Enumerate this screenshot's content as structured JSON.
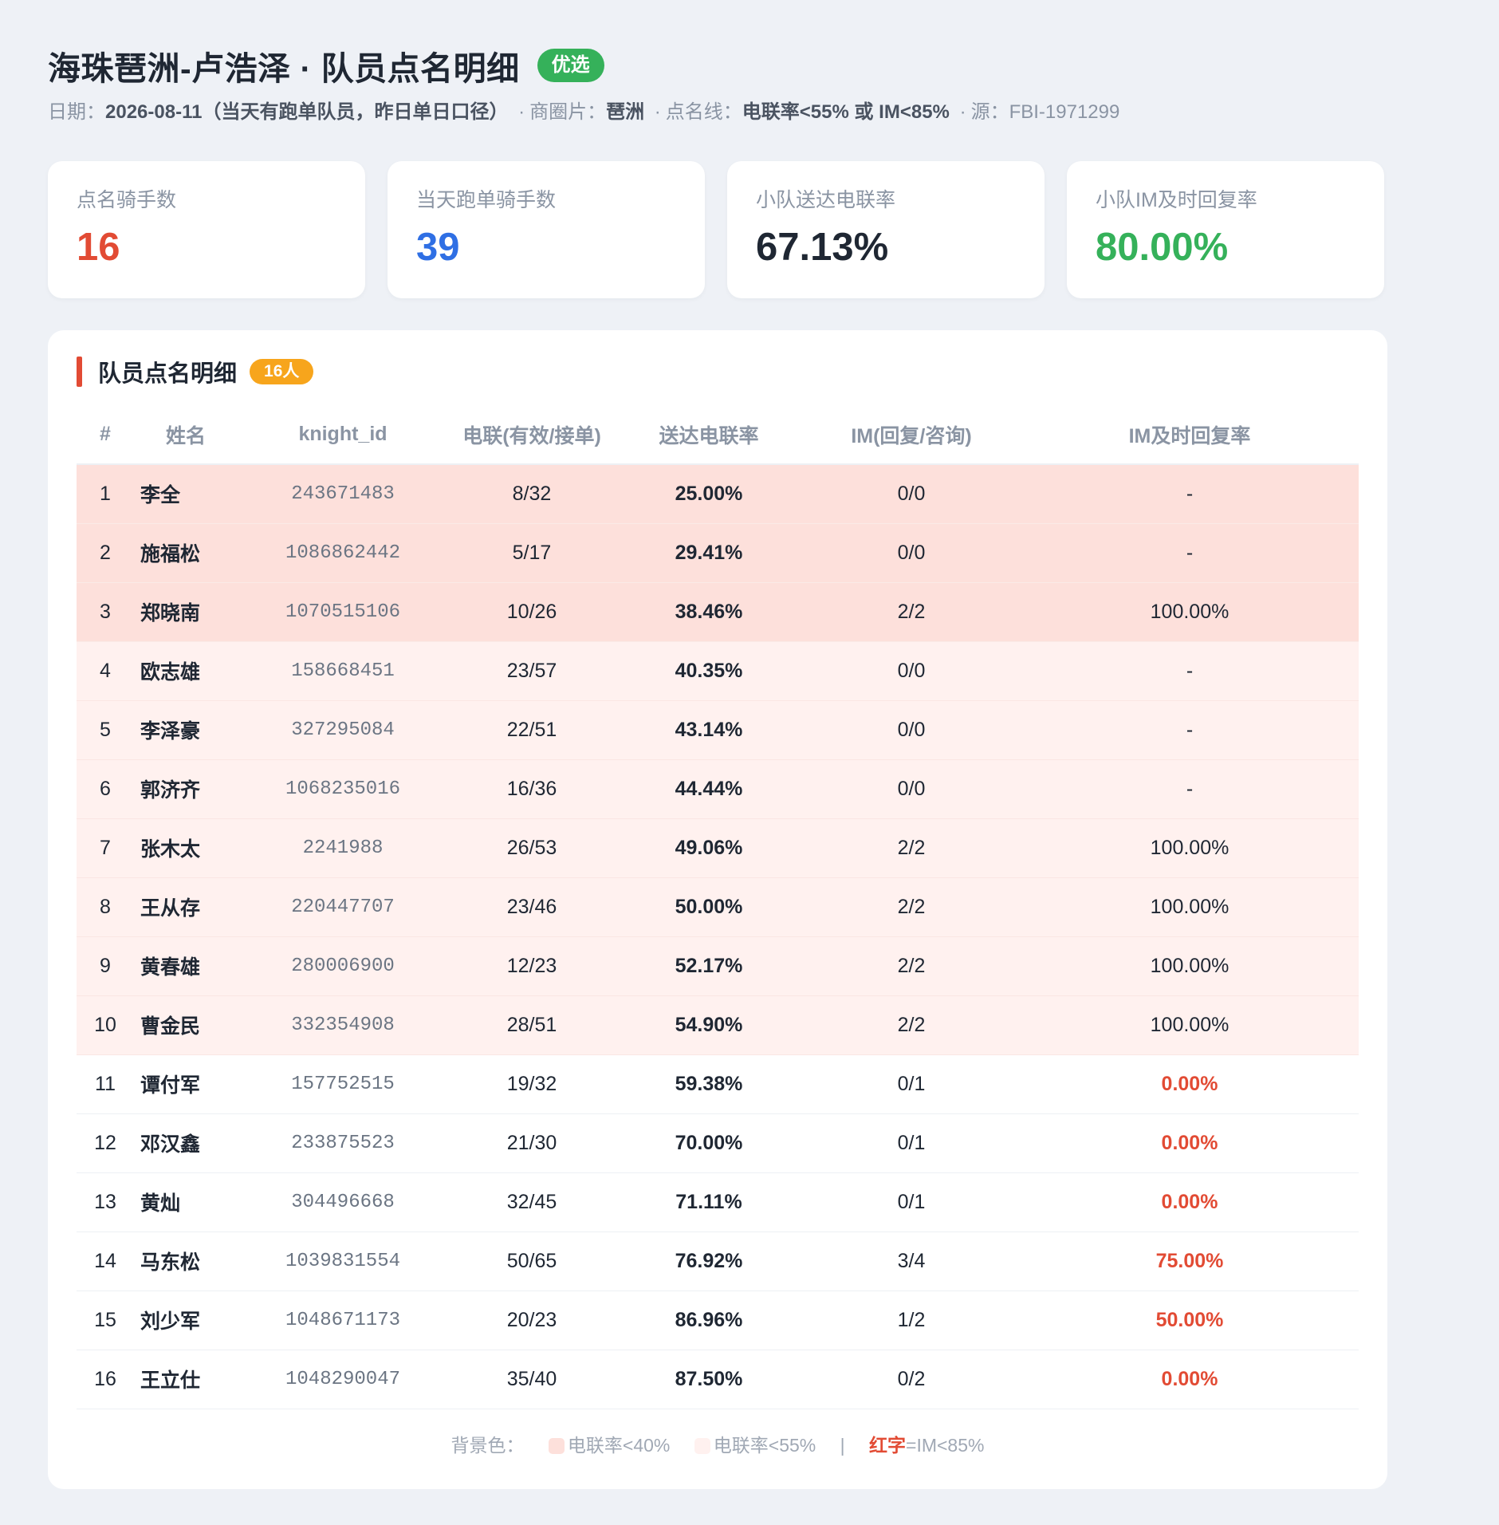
{
  "header": {
    "title": "海珠琶洲-卢浩泽 · 队员点名明细",
    "badge": "优选",
    "meta": {
      "date_label": "日期：",
      "date_value": "2026-08-11（当天有跑单队员，昨日单日口径）",
      "area_label": "商圈片：",
      "area_value": "琶洲",
      "line_label": "点名线：",
      "line_value": "电联率<55% 或 IM<85%",
      "source": "源：FBI-1971299"
    }
  },
  "cards": [
    {
      "label": "点名骑手数",
      "value": "16",
      "color": "#e24b34"
    },
    {
      "label": "当天跑单骑手数",
      "value": "39",
      "color": "#2f6fe4"
    },
    {
      "label": "小队送达电联率",
      "value": "67.13%",
      "color": "#1f2733"
    },
    {
      "label": "小队IM及时回复率",
      "value": "80.00%",
      "color": "#35b15a"
    }
  ],
  "panel": {
    "title": "队员点名明细",
    "count_badge": "16人"
  },
  "table": {
    "columns": [
      "#",
      "姓名",
      "knight_id",
      "电联(有效/接单)",
      "送达电联率",
      "IM(回复/咨询)",
      "IM及时回复率"
    ],
    "rows": [
      {
        "idx": "1",
        "name": "李全",
        "knight_id": "243671483",
        "call": "8/32",
        "rate": "25.00%",
        "im": "0/0",
        "im_rate": "-",
        "bg": "dark",
        "im_red": false
      },
      {
        "idx": "2",
        "name": "施福松",
        "knight_id": "1086862442",
        "call": "5/17",
        "rate": "29.41%",
        "im": "0/0",
        "im_rate": "-",
        "bg": "dark",
        "im_red": false
      },
      {
        "idx": "3",
        "name": "郑晓南",
        "knight_id": "1070515106",
        "call": "10/26",
        "rate": "38.46%",
        "im": "2/2",
        "im_rate": "100.00%",
        "bg": "dark",
        "im_red": false
      },
      {
        "idx": "4",
        "name": "欧志雄",
        "knight_id": "158668451",
        "call": "23/57",
        "rate": "40.35%",
        "im": "0/0",
        "im_rate": "-",
        "bg": "light",
        "im_red": false
      },
      {
        "idx": "5",
        "name": "李泽豪",
        "knight_id": "327295084",
        "call": "22/51",
        "rate": "43.14%",
        "im": "0/0",
        "im_rate": "-",
        "bg": "light",
        "im_red": false
      },
      {
        "idx": "6",
        "name": "郭济齐",
        "knight_id": "1068235016",
        "call": "16/36",
        "rate": "44.44%",
        "im": "0/0",
        "im_rate": "-",
        "bg": "light",
        "im_red": false
      },
      {
        "idx": "7",
        "name": "张木太",
        "knight_id": "2241988",
        "call": "26/53",
        "rate": "49.06%",
        "im": "2/2",
        "im_rate": "100.00%",
        "bg": "light",
        "im_red": false
      },
      {
        "idx": "8",
        "name": "王从存",
        "knight_id": "220447707",
        "call": "23/46",
        "rate": "50.00%",
        "im": "2/2",
        "im_rate": "100.00%",
        "bg": "light",
        "im_red": false
      },
      {
        "idx": "9",
        "name": "黄春雄",
        "knight_id": "280006900",
        "call": "12/23",
        "rate": "52.17%",
        "im": "2/2",
        "im_rate": "100.00%",
        "bg": "light",
        "im_red": false
      },
      {
        "idx": "10",
        "name": "曹金民",
        "knight_id": "332354908",
        "call": "28/51",
        "rate": "54.90%",
        "im": "2/2",
        "im_rate": "100.00%",
        "bg": "light",
        "im_red": false
      },
      {
        "idx": "11",
        "name": "谭付军",
        "knight_id": "157752515",
        "call": "19/32",
        "rate": "59.38%",
        "im": "0/1",
        "im_rate": "0.00%",
        "bg": "none",
        "im_red": true
      },
      {
        "idx": "12",
        "name": "邓汉鑫",
        "knight_id": "233875523",
        "call": "21/30",
        "rate": "70.00%",
        "im": "0/1",
        "im_rate": "0.00%",
        "bg": "none",
        "im_red": true
      },
      {
        "idx": "13",
        "name": "黄灿",
        "knight_id": "304496668",
        "call": "32/45",
        "rate": "71.11%",
        "im": "0/1",
        "im_rate": "0.00%",
        "bg": "none",
        "im_red": true
      },
      {
        "idx": "14",
        "name": "马东松",
        "knight_id": "1039831554",
        "call": "50/65",
        "rate": "76.92%",
        "im": "3/4",
        "im_rate": "75.00%",
        "bg": "none",
        "im_red": true
      },
      {
        "idx": "15",
        "name": "刘少军",
        "knight_id": "1048671173",
        "call": "20/23",
        "rate": "86.96%",
        "im": "1/2",
        "im_rate": "50.00%",
        "bg": "none",
        "im_red": true
      },
      {
        "idx": "16",
        "name": "王立仕",
        "knight_id": "1048290047",
        "call": "35/40",
        "rate": "87.50%",
        "im": "0/2",
        "im_rate": "0.00%",
        "bg": "none",
        "im_red": true
      }
    ]
  },
  "legend": {
    "prefix": "背景色：",
    "dark_label": "电联率<40%",
    "dark_color": "#fde0db",
    "light_label": "电联率<55%",
    "light_color": "#fff1ef",
    "divider": "|",
    "red_word": "红字",
    "red_rest": "=IM<85%"
  }
}
